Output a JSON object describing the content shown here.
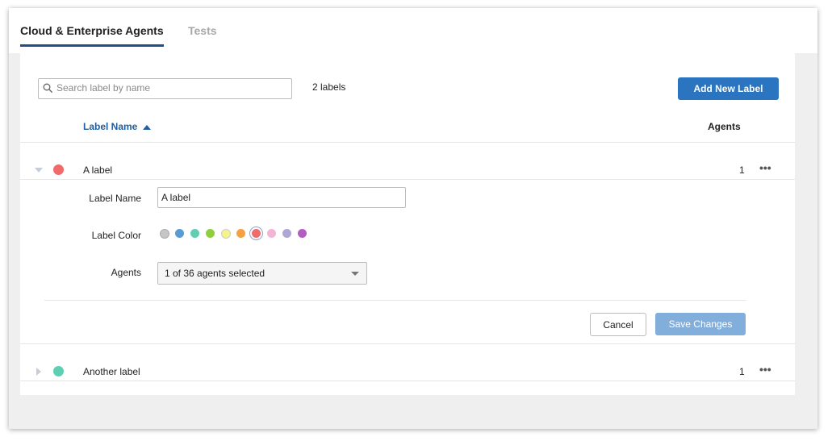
{
  "tabs": [
    {
      "label": "Cloud & Enterprise Agents",
      "active": true
    },
    {
      "label": "Tests",
      "active": false
    }
  ],
  "search": {
    "placeholder": "Search label by name",
    "value": ""
  },
  "label_count": "2 labels",
  "add_button": "Add New Label",
  "table": {
    "headers": {
      "name": "Label Name",
      "agents": "Agents"
    },
    "sort": "ascending"
  },
  "rows": [
    {
      "name": "A label",
      "color": "#f26b6b",
      "agents": "1",
      "expanded": true
    },
    {
      "name": "Another label",
      "color": "#5fcfb3",
      "agents": "1",
      "expanded": false
    }
  ],
  "editor": {
    "name_label": "Label Name",
    "name_value": "A label",
    "color_label": "Label Color",
    "colors": [
      "#c6c6c6",
      "#5b9bd1",
      "#5fcfb3",
      "#8fcf3f",
      "#f4f48a",
      "#f5a042",
      "#f26b6b",
      "#f4b4d6",
      "#b0a6d6",
      "#b25ec0"
    ],
    "selected_color": "#f26b6b",
    "agents_label": "Agents",
    "agents_value": "1 of 36 agents selected",
    "cancel": "Cancel",
    "save": "Save Changes"
  },
  "icons": {
    "search": "search-icon",
    "more": "more-horizontal-icon",
    "sort": "sort-ascending-icon"
  }
}
